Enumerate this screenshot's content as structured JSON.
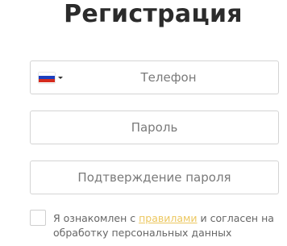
{
  "page": {
    "title": "Регистрация"
  },
  "form": {
    "phone": {
      "placeholder": "Телефон",
      "country_flag": "russia-flag-icon",
      "flag_colors": [
        "#ffffff",
        "#1c3fbf",
        "#d52b1e"
      ]
    },
    "password": {
      "placeholder": "Пароль"
    },
    "password_confirm": {
      "placeholder": "Подтверждение пароля"
    },
    "agreement": {
      "checked": false,
      "text_before": "Я ознакомлен с ",
      "link_text": "правилами",
      "text_after": " и согласен на обработку персональных данных"
    }
  },
  "colors": {
    "link": "#ecc75f",
    "border": "#d4d4d4",
    "title": "#2b2b2b",
    "placeholder": "#7a7a7a"
  }
}
